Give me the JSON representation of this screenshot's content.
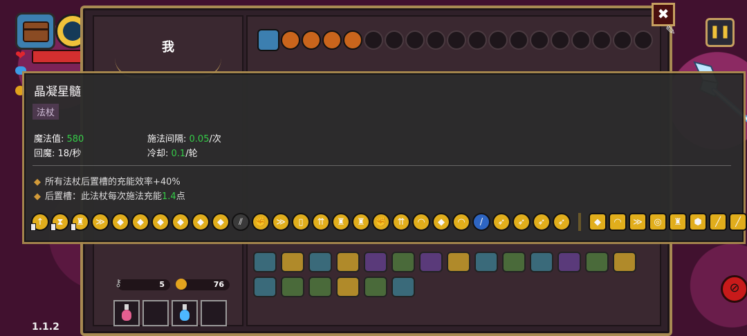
{
  "hud": {
    "version": "1.1.2",
    "icons": [
      "chest-icon",
      "wand-icon",
      "heart-icon",
      "mana-icon",
      "coin-icon"
    ],
    "health_fraction": 0.95
  },
  "panel": {
    "character_name": "我",
    "keys": "5",
    "coins": "76",
    "inventory": [
      "pink-potion",
      "empty",
      "blue-potion",
      "empty"
    ]
  },
  "buttons": {
    "close": "✖",
    "pause": "❚❚",
    "edit": "✎"
  },
  "tooltip": {
    "name": "晶凝星髓",
    "type": "法杖",
    "mana_label": "魔法值: ",
    "mana_value": "580",
    "regen_label": "回魔: 18/秒",
    "cast_interval_label": "施法间隔: ",
    "cast_interval_value": "0.05",
    "cast_interval_unit": "/次",
    "cooldown_label": "冷却: ",
    "cooldown_value": "0.1",
    "cooldown_unit": "/轮",
    "effect1": "所有法杖后置槽的充能效率+40%",
    "effect2_prefix": "后置槽：此法杖每次施法充能",
    "effect2_value": "1.4",
    "effect2_suffix": "点",
    "bullet": "◆"
  },
  "colors": {
    "accent_gold": "#a8894e",
    "good_green": "#35d44a",
    "tooltip_bg": "#2c2c2c"
  }
}
